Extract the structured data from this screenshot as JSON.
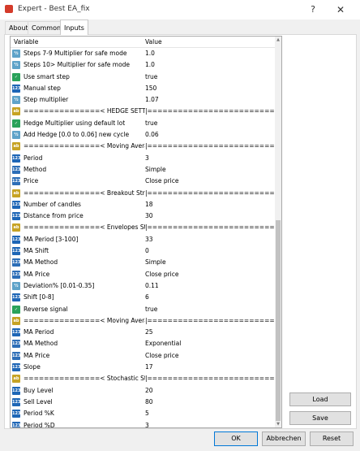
{
  "window": {
    "title": "Expert - Best EA_fix",
    "help_label": "?",
    "close_label": "✕"
  },
  "tabs": [
    {
      "label": "About"
    },
    {
      "label": "Common"
    },
    {
      "label": "Inputs"
    }
  ],
  "table": {
    "col_variable": "Variable",
    "col_value": "Value",
    "rows": [
      {
        "icon": "dbl",
        "variable": "Steps 7-9 Multiplier for safe mode",
        "value": "1.0"
      },
      {
        "icon": "dbl",
        "variable": "Steps 10> Multiplier for safe mode",
        "value": "1.0"
      },
      {
        "icon": "bool",
        "variable": "Use smart step",
        "value": "true"
      },
      {
        "icon": "num",
        "variable": "Manual step",
        "value": "150"
      },
      {
        "icon": "dbl",
        "variable": "Step multiplier",
        "value": "1.07"
      },
      {
        "icon": "str",
        "variable": "===============< HEDGE SETTING ...",
        "value": "|=========================|"
      },
      {
        "icon": "bool",
        "variable": "Hedge Multiplier using default lot",
        "value": "true"
      },
      {
        "icon": "dbl",
        "variable": "Add Hedge [0.0 to 0.06] new cycle",
        "value": "0.06"
      },
      {
        "icon": "str",
        "variable": "===============< Moving Average S...",
        "value": "|=========================|"
      },
      {
        "icon": "num",
        "variable": "Period",
        "value": "3"
      },
      {
        "icon": "enum",
        "variable": "Method",
        "value": "Simple"
      },
      {
        "icon": "enum",
        "variable": "Price",
        "value": "Close price"
      },
      {
        "icon": "str",
        "variable": "===============< Breakout Strategy ...",
        "value": "|=========================|"
      },
      {
        "icon": "num",
        "variable": "Number of candles",
        "value": "18"
      },
      {
        "icon": "num",
        "variable": "Distance from price",
        "value": "30"
      },
      {
        "icon": "str",
        "variable": "===============< Envelopes Strateg...",
        "value": "|=========================|"
      },
      {
        "icon": "num",
        "variable": "MA Period [3-100]",
        "value": "33"
      },
      {
        "icon": "num",
        "variable": "MA Shift",
        "value": "0"
      },
      {
        "icon": "enum",
        "variable": "MA Method",
        "value": "Simple"
      },
      {
        "icon": "enum",
        "variable": "MA Price",
        "value": "Close price"
      },
      {
        "icon": "dbl",
        "variable": "Deviation% [0.01-0.35]",
        "value": "0.11"
      },
      {
        "icon": "num",
        "variable": "Shift [0-8]",
        "value": "6"
      },
      {
        "icon": "bool",
        "variable": "Reverse signal",
        "value": "true"
      },
      {
        "icon": "str",
        "variable": "===============< Moving Average S...",
        "value": "|=========================|"
      },
      {
        "icon": "num",
        "variable": "MA Period",
        "value": "25"
      },
      {
        "icon": "enum",
        "variable": "MA Method",
        "value": "Exponential"
      },
      {
        "icon": "enum",
        "variable": "MA Price",
        "value": "Close price"
      },
      {
        "icon": "num",
        "variable": "Slope",
        "value": "17"
      },
      {
        "icon": "str",
        "variable": "===============< Stochastic Strateg...",
        "value": "|=========================|"
      },
      {
        "icon": "num",
        "variable": "Buy Level",
        "value": "20"
      },
      {
        "icon": "num",
        "variable": "Sell Level",
        "value": "80"
      },
      {
        "icon": "num",
        "variable": "Period %K",
        "value": "5"
      },
      {
        "icon": "num",
        "variable": "Period %D",
        "value": "3"
      }
    ]
  },
  "icon_labels": {
    "num": "123",
    "bool": "✓",
    "str": "ab",
    "dbl": "½",
    "enum": "123"
  },
  "side_buttons": {
    "load": "Load",
    "save": "Save"
  },
  "footer": {
    "ok": "OK",
    "cancel": "Abbrechen",
    "reset": "Reset"
  }
}
